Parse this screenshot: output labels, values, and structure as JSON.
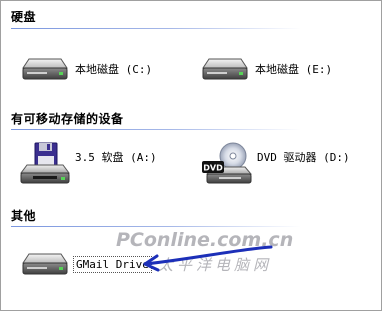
{
  "sections": [
    {
      "title": "硬盘"
    },
    {
      "title": "有可移动存储的设备"
    },
    {
      "title": "其他"
    }
  ],
  "drives": {
    "c": {
      "label": "本地磁盘 (C:)",
      "icon": "hard-drive-icon"
    },
    "e": {
      "label": "本地磁盘 (E:)",
      "icon": "hard-drive-icon"
    },
    "a": {
      "label": "3.5 软盘 (A:)",
      "icon": "floppy-drive-icon"
    },
    "d": {
      "label": "DVD 驱动器 (D:)",
      "icon": "dvd-drive-icon"
    },
    "gmail": {
      "label": "GMail Drive",
      "icon": "network-drive-icon"
    }
  },
  "dvd_badge": "DVD",
  "watermark": {
    "line1": "PConline.com.cn",
    "line2": "太平洋电脑网"
  },
  "colors": {
    "divider": "#7a96df",
    "arrow": "#1c2fb8"
  }
}
